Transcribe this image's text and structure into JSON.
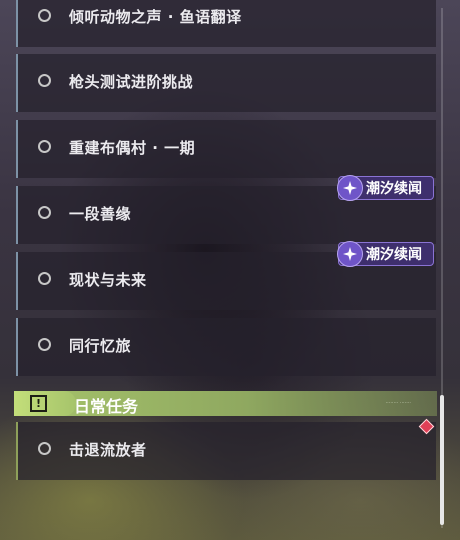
{
  "quests": [
    {
      "label": "倾听动物之声 · 鱼语翻译",
      "badge": null
    },
    {
      "label": "枪头测试进阶挑战",
      "badge": null
    },
    {
      "label": "重建布偶村 · 一期",
      "badge": null
    },
    {
      "label": "一段善缘",
      "badge": "潮汐续闻"
    },
    {
      "label": "现状与未来",
      "badge": "潮汐续闻"
    },
    {
      "label": "同行忆旅",
      "badge": null
    }
  ],
  "daily_section": {
    "title": "日常任务",
    "alert_symbol": "!",
    "subtitle": "········ ·······"
  },
  "daily_quests": [
    {
      "label": "击退流放者"
    }
  ],
  "colors": {
    "accent_blue_bar": "#7d92a6",
    "daily_green": "#a6c46b",
    "badge_purple": "#3e2f6d",
    "marker_red": "#e04057"
  },
  "icons": {
    "status": "circle-icon",
    "badge": "tide-star-icon",
    "section": "alert-icon",
    "marker": "diamond-marker-icon"
  }
}
